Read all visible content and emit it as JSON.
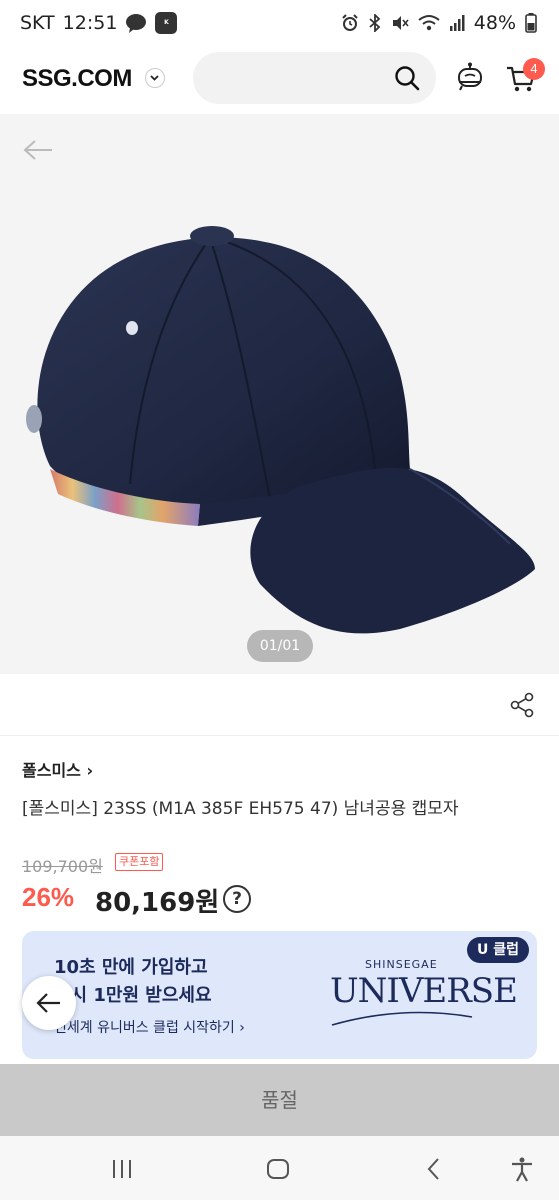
{
  "status_bar": {
    "carrier": "SKT",
    "time": "12:51",
    "battery": "48%"
  },
  "header": {
    "logo": "SSG.COM",
    "cart_count": "4"
  },
  "gallery": {
    "indicator": "01/01"
  },
  "product": {
    "brand": "폴스미스 ›",
    "name": "[폴스미스] 23SS (M1A 385F EH575 47) 남녀공용 캡모자",
    "original_price": "109,700원",
    "coupon_label": "쿠폰포함",
    "discount": "26%",
    "sale_price": "80,169원",
    "help": "?"
  },
  "banner": {
    "line1": "10초 만에 가입하고",
    "line2": "즉시 1만원 받으세요",
    "link": "신세계 유니버스 클럽 시작하기 ›",
    "badge": "U 클럽",
    "brand_small": "SHINSEGAE",
    "brand_big": "UNIVERSE"
  },
  "footer": {
    "soldout_label": "품절"
  },
  "colors": {
    "accent": "#ff5a4e",
    "navy": "#1c2a5c",
    "banner_bg": "#dfe8fb"
  },
  "icons": [
    "search-icon",
    "bot-icon",
    "cart-icon",
    "back-arrow-icon",
    "share-icon",
    "help-icon",
    "recent-apps-icon",
    "home-icon",
    "nav-back-icon",
    "accessibility-icon"
  ]
}
